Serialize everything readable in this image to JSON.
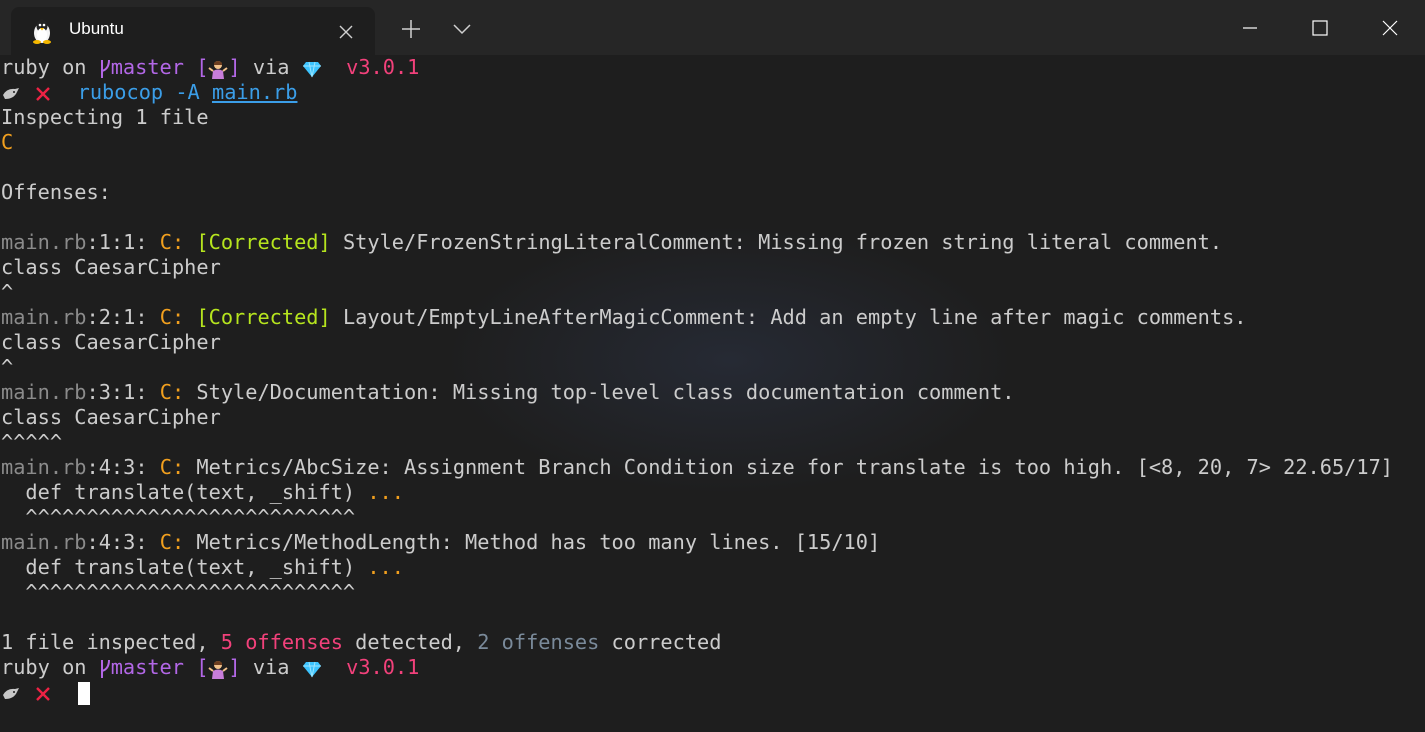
{
  "tab": {
    "title": "Ubuntu"
  },
  "icons": {
    "tab": "linux-tux-icon",
    "close_tab": "close-icon",
    "new_tab": "plus-icon",
    "dropdown": "chevron-down-icon",
    "minimize": "minimize-icon",
    "maximize": "maximize-icon",
    "close_window": "close-icon",
    "branch": "git-branch-icon",
    "gem": "ruby-gem-icon",
    "prompt": "shell-prompt-icon",
    "status": "error-x-icon",
    "stash": "person-shrugging-emoji"
  },
  "colors": {
    "background": "#1e1e1e",
    "foreground": "#cccccc",
    "path": "#8b8b8b",
    "branch": "#b267e6",
    "version": "#f2417b",
    "error": "#ee2244",
    "command": "#3b9ee8",
    "severity": "#f2a01e",
    "corrected": "#b6e51e",
    "offense_count": "#f2417b",
    "corrected_count": "#7a8a9a"
  },
  "prompt": {
    "dir": "ruby",
    "on": "on",
    "branch": "master",
    "bracket_open": "[",
    "bracket_close": "]",
    "via": "via",
    "version": "v3.0.1"
  },
  "command": {
    "name": "rubocop",
    "flag": "-A",
    "file": "main.rb"
  },
  "output": {
    "inspecting": "Inspecting 1 file",
    "progress": "C",
    "offenses_header": "Offenses:",
    "offenses": [
      {
        "file": "main.rb",
        "loc": ":1:1:",
        "sev": "C:",
        "tag": "[Corrected]",
        "msg": "Style/FrozenStringLiteralComment: Missing frozen string literal comment.",
        "code": "class CaesarCipher",
        "ell": "",
        "caret": "^"
      },
      {
        "file": "main.rb",
        "loc": ":2:1:",
        "sev": "C:",
        "tag": "[Corrected]",
        "msg": "Layout/EmptyLineAfterMagicComment: Add an empty line after magic comments.",
        "code": "class CaesarCipher",
        "ell": "",
        "caret": "^"
      },
      {
        "file": "main.rb",
        "loc": ":3:1:",
        "sev": "C:",
        "tag": "",
        "msg": "Style/Documentation: Missing top-level class documentation comment.",
        "code": "class CaesarCipher",
        "ell": "",
        "caret": "^^^^^"
      },
      {
        "file": "main.rb",
        "loc": ":4:3:",
        "sev": "C:",
        "tag": "",
        "msg": "Metrics/AbcSize: Assignment Branch Condition size for translate is too high. [<8, 20, 7> 22.65/17]",
        "code": "  def translate(text, _shift) ",
        "ell": "...",
        "caret": "  ^^^^^^^^^^^^^^^^^^^^^^^^^^^"
      },
      {
        "file": "main.rb",
        "loc": ":4:3:",
        "sev": "C:",
        "tag": "",
        "msg": "Metrics/MethodLength: Method has too many lines. [15/10]",
        "code": "  def translate(text, _shift) ",
        "ell": "...",
        "caret": "  ^^^^^^^^^^^^^^^^^^^^^^^^^^^"
      }
    ],
    "summary": {
      "inspected": "1 file inspected, ",
      "offenses": "5 offenses",
      "detected": " detected, ",
      "corrected_count": "2 offenses",
      "corrected": " corrected"
    }
  }
}
